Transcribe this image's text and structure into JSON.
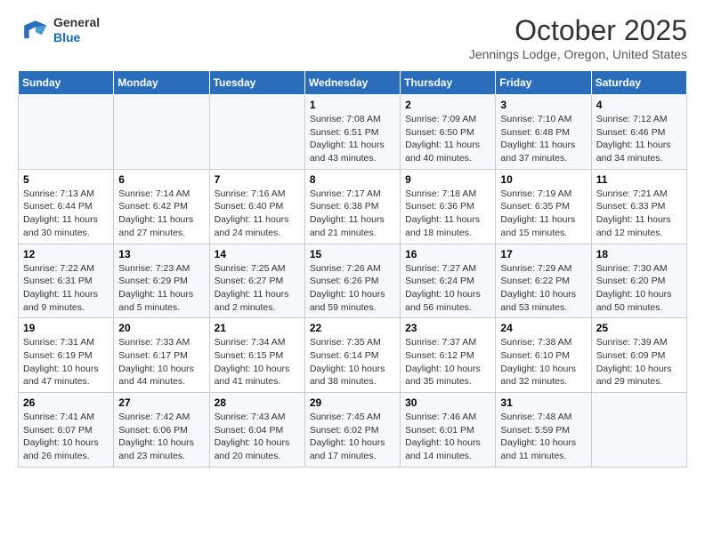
{
  "header": {
    "logo": {
      "line1": "General",
      "line2": "Blue"
    },
    "title": "October 2025",
    "subtitle": "Jennings Lodge, Oregon, United States"
  },
  "weekdays": [
    "Sunday",
    "Monday",
    "Tuesday",
    "Wednesday",
    "Thursday",
    "Friday",
    "Saturday"
  ],
  "weeks": [
    [
      {
        "day": "",
        "info": ""
      },
      {
        "day": "",
        "info": ""
      },
      {
        "day": "",
        "info": ""
      },
      {
        "day": "1",
        "info": "Sunrise: 7:08 AM\nSunset: 6:51 PM\nDaylight: 11 hours\nand 43 minutes."
      },
      {
        "day": "2",
        "info": "Sunrise: 7:09 AM\nSunset: 6:50 PM\nDaylight: 11 hours\nand 40 minutes."
      },
      {
        "day": "3",
        "info": "Sunrise: 7:10 AM\nSunset: 6:48 PM\nDaylight: 11 hours\nand 37 minutes."
      },
      {
        "day": "4",
        "info": "Sunrise: 7:12 AM\nSunset: 6:46 PM\nDaylight: 11 hours\nand 34 minutes."
      }
    ],
    [
      {
        "day": "5",
        "info": "Sunrise: 7:13 AM\nSunset: 6:44 PM\nDaylight: 11 hours\nand 30 minutes."
      },
      {
        "day": "6",
        "info": "Sunrise: 7:14 AM\nSunset: 6:42 PM\nDaylight: 11 hours\nand 27 minutes."
      },
      {
        "day": "7",
        "info": "Sunrise: 7:16 AM\nSunset: 6:40 PM\nDaylight: 11 hours\nand 24 minutes."
      },
      {
        "day": "8",
        "info": "Sunrise: 7:17 AM\nSunset: 6:38 PM\nDaylight: 11 hours\nand 21 minutes."
      },
      {
        "day": "9",
        "info": "Sunrise: 7:18 AM\nSunset: 6:36 PM\nDaylight: 11 hours\nand 18 minutes."
      },
      {
        "day": "10",
        "info": "Sunrise: 7:19 AM\nSunset: 6:35 PM\nDaylight: 11 hours\nand 15 minutes."
      },
      {
        "day": "11",
        "info": "Sunrise: 7:21 AM\nSunset: 6:33 PM\nDaylight: 11 hours\nand 12 minutes."
      }
    ],
    [
      {
        "day": "12",
        "info": "Sunrise: 7:22 AM\nSunset: 6:31 PM\nDaylight: 11 hours\nand 9 minutes."
      },
      {
        "day": "13",
        "info": "Sunrise: 7:23 AM\nSunset: 6:29 PM\nDaylight: 11 hours\nand 5 minutes."
      },
      {
        "day": "14",
        "info": "Sunrise: 7:25 AM\nSunset: 6:27 PM\nDaylight: 11 hours\nand 2 minutes."
      },
      {
        "day": "15",
        "info": "Sunrise: 7:26 AM\nSunset: 6:26 PM\nDaylight: 10 hours\nand 59 minutes."
      },
      {
        "day": "16",
        "info": "Sunrise: 7:27 AM\nSunset: 6:24 PM\nDaylight: 10 hours\nand 56 minutes."
      },
      {
        "day": "17",
        "info": "Sunrise: 7:29 AM\nSunset: 6:22 PM\nDaylight: 10 hours\nand 53 minutes."
      },
      {
        "day": "18",
        "info": "Sunrise: 7:30 AM\nSunset: 6:20 PM\nDaylight: 10 hours\nand 50 minutes."
      }
    ],
    [
      {
        "day": "19",
        "info": "Sunrise: 7:31 AM\nSunset: 6:19 PM\nDaylight: 10 hours\nand 47 minutes."
      },
      {
        "day": "20",
        "info": "Sunrise: 7:33 AM\nSunset: 6:17 PM\nDaylight: 10 hours\nand 44 minutes."
      },
      {
        "day": "21",
        "info": "Sunrise: 7:34 AM\nSunset: 6:15 PM\nDaylight: 10 hours\nand 41 minutes."
      },
      {
        "day": "22",
        "info": "Sunrise: 7:35 AM\nSunset: 6:14 PM\nDaylight: 10 hours\nand 38 minutes."
      },
      {
        "day": "23",
        "info": "Sunrise: 7:37 AM\nSunset: 6:12 PM\nDaylight: 10 hours\nand 35 minutes."
      },
      {
        "day": "24",
        "info": "Sunrise: 7:38 AM\nSunset: 6:10 PM\nDaylight: 10 hours\nand 32 minutes."
      },
      {
        "day": "25",
        "info": "Sunrise: 7:39 AM\nSunset: 6:09 PM\nDaylight: 10 hours\nand 29 minutes."
      }
    ],
    [
      {
        "day": "26",
        "info": "Sunrise: 7:41 AM\nSunset: 6:07 PM\nDaylight: 10 hours\nand 26 minutes."
      },
      {
        "day": "27",
        "info": "Sunrise: 7:42 AM\nSunset: 6:06 PM\nDaylight: 10 hours\nand 23 minutes."
      },
      {
        "day": "28",
        "info": "Sunrise: 7:43 AM\nSunset: 6:04 PM\nDaylight: 10 hours\nand 20 minutes."
      },
      {
        "day": "29",
        "info": "Sunrise: 7:45 AM\nSunset: 6:02 PM\nDaylight: 10 hours\nand 17 minutes."
      },
      {
        "day": "30",
        "info": "Sunrise: 7:46 AM\nSunset: 6:01 PM\nDaylight: 10 hours\nand 14 minutes."
      },
      {
        "day": "31",
        "info": "Sunrise: 7:48 AM\nSunset: 5:59 PM\nDaylight: 10 hours\nand 11 minutes."
      },
      {
        "day": "",
        "info": ""
      }
    ]
  ]
}
